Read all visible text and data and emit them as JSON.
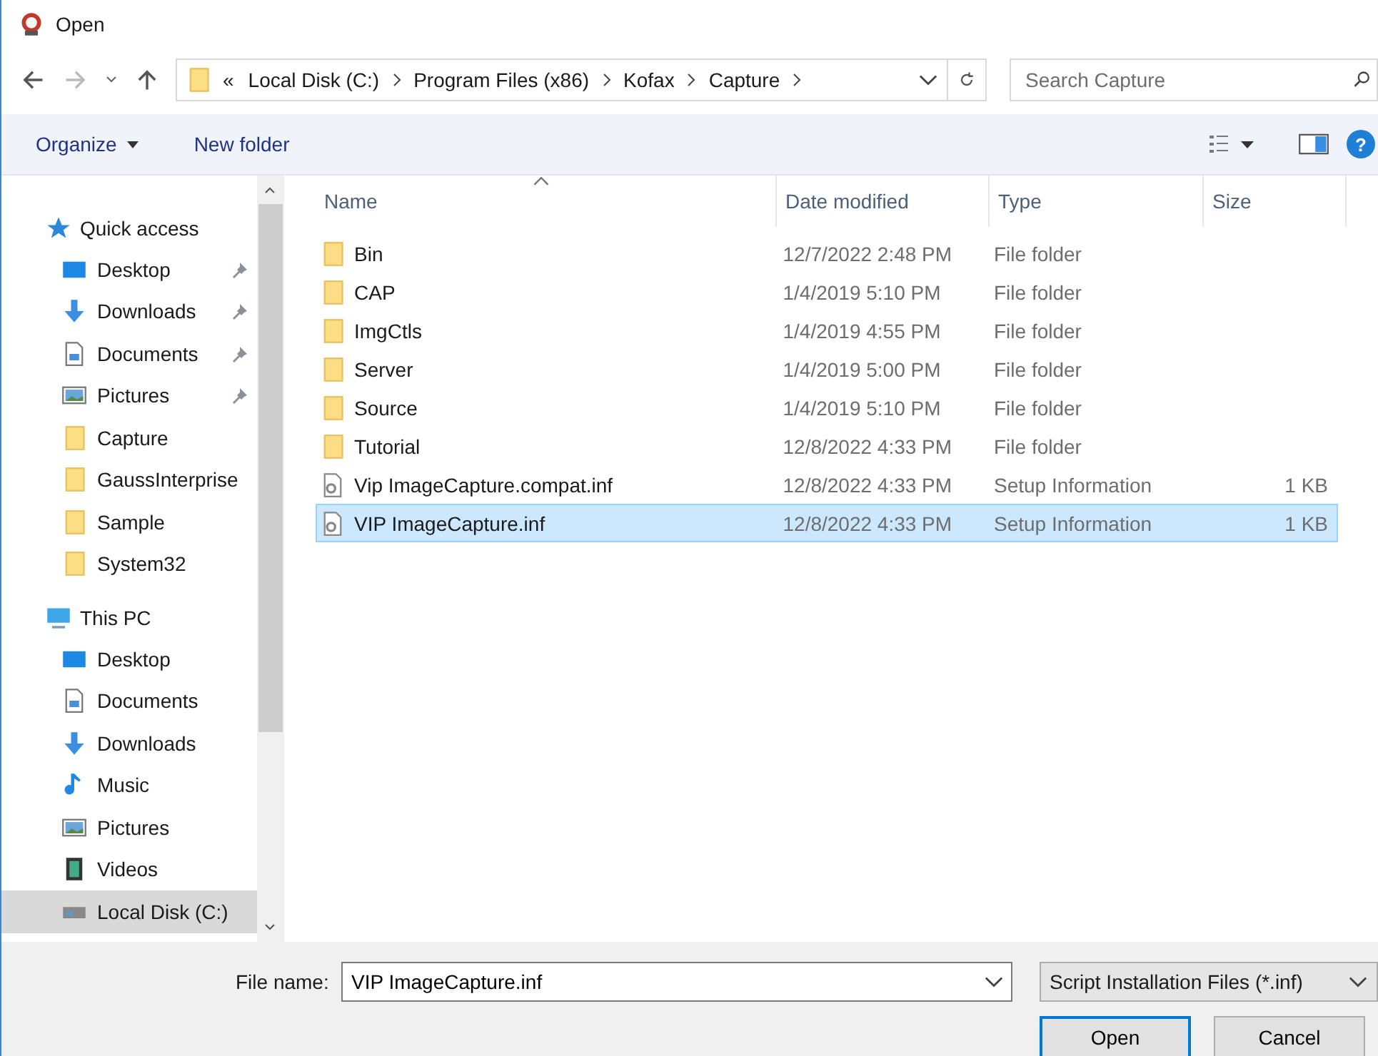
{
  "window": {
    "title": "Open"
  },
  "breadcrumb": {
    "overflow": "«",
    "segments": [
      "Local Disk (C:)",
      "Program Files (x86)",
      "Kofax",
      "Capture"
    ]
  },
  "search": {
    "placeholder": "Search Capture"
  },
  "toolbar": {
    "organize": "Organize",
    "new_folder": "New folder",
    "help": "?"
  },
  "sidebar": {
    "groups": [
      {
        "label": "Quick access",
        "kind": "star",
        "children": [
          {
            "label": "Desktop",
            "kind": "desktop",
            "pinned": true,
            "selected": false
          },
          {
            "label": "Downloads",
            "kind": "download",
            "pinned": true,
            "selected": false
          },
          {
            "label": "Documents",
            "kind": "document",
            "pinned": true,
            "selected": false
          },
          {
            "label": "Pictures",
            "kind": "picture",
            "pinned": true,
            "selected": false
          },
          {
            "label": "Capture",
            "kind": "folder",
            "pinned": false,
            "selected": false
          },
          {
            "label": "GaussInterprise",
            "kind": "folder",
            "pinned": false,
            "selected": false
          },
          {
            "label": "Sample",
            "kind": "folder",
            "pinned": false,
            "selected": false
          },
          {
            "label": "System32",
            "kind": "folder",
            "pinned": false,
            "selected": false
          }
        ]
      },
      {
        "label": "This PC",
        "kind": "computer",
        "children": [
          {
            "label": "Desktop",
            "kind": "desktop",
            "pinned": false,
            "selected": false
          },
          {
            "label": "Documents",
            "kind": "document",
            "pinned": false,
            "selected": false
          },
          {
            "label": "Downloads",
            "kind": "download",
            "pinned": false,
            "selected": false
          },
          {
            "label": "Music",
            "kind": "music",
            "pinned": false,
            "selected": false
          },
          {
            "label": "Pictures",
            "kind": "picture",
            "pinned": false,
            "selected": false
          },
          {
            "label": "Videos",
            "kind": "video",
            "pinned": false,
            "selected": false
          },
          {
            "label": "Local Disk (C:)",
            "kind": "disk",
            "pinned": false,
            "selected": true
          }
        ]
      }
    ]
  },
  "table": {
    "columns": [
      "Name",
      "Date modified",
      "Type",
      "Size"
    ],
    "rows": [
      {
        "kind": "folder",
        "name": "Bin",
        "date": "12/7/2022 2:48 PM",
        "type": "File folder",
        "selected": false
      },
      {
        "kind": "folder",
        "name": "CAP",
        "date": "1/4/2019 5:10 PM",
        "type": "File folder",
        "selected": false
      },
      {
        "kind": "folder",
        "name": "ImgCtls",
        "date": "1/4/2019 4:55 PM",
        "type": "File folder",
        "selected": false
      },
      {
        "kind": "folder",
        "name": "Server",
        "date": "1/4/2019 5:00 PM",
        "type": "File folder",
        "selected": false
      },
      {
        "kind": "folder",
        "name": "Source",
        "date": "1/4/2019 5:10 PM",
        "type": "File folder",
        "selected": false
      },
      {
        "kind": "folder",
        "name": "Tutorial",
        "date": "12/8/2022 4:33 PM",
        "type": "File folder",
        "selected": false
      },
      {
        "kind": "file",
        "name": "Vip ImageCapture.compat.inf",
        "date": "12/8/2022 4:33 PM",
        "type": "Setup Information",
        "size": "1 KB",
        "selected": false
      },
      {
        "kind": "file",
        "name": "VIP ImageCapture.inf",
        "date": "12/8/2022 4:33 PM",
        "type": "Setup Information",
        "size": "1 KB",
        "selected": true
      }
    ]
  },
  "footer": {
    "file_name_label": "File name:",
    "file_name": "VIP ImageCapture.inf",
    "file_type": "Script Installation Files (*.inf)",
    "buttons": [
      "Open",
      "Cancel"
    ]
  }
}
